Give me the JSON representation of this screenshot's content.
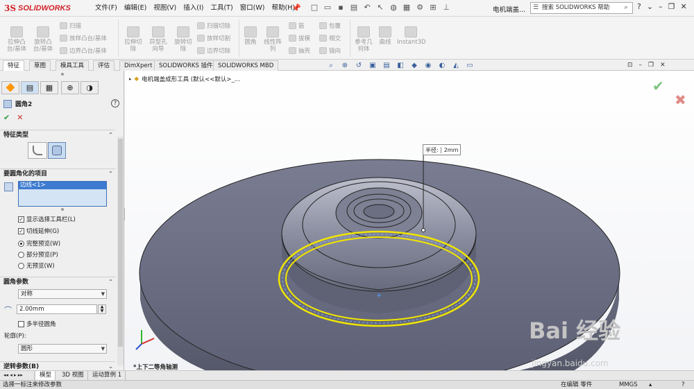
{
  "app": {
    "brand_mark": "3S",
    "brand_name": "SOLIDWORKS"
  },
  "menu": [
    "文件(F)",
    "编辑(E)",
    "视图(V)",
    "插入(I)",
    "工具(T)",
    "窗口(W)",
    "帮助(H)"
  ],
  "doc_title": "电机端盖...",
  "help_search_placeholder": "搜索 SOLIDWORKS 帮助",
  "commands": {
    "extrude_boss": "拉伸凸\n台/基体",
    "revolve_boss": "旋转凸\n台/基体",
    "sweep": "扫描",
    "loft": "放样凸台/基体",
    "boundary": "边界凸台/基体",
    "extrude_cut": "拉伸切\n除",
    "hole_wizard": "异型孔\n向导",
    "revolve_cut": "旋转切\n除",
    "sweep_cut": "扫描切除",
    "loft_cut": "放样切割",
    "boundary_cut": "边界切除",
    "fillet": "圆角",
    "linear_pattern": "线性阵\n列",
    "rib": "筋",
    "draft": "拔模",
    "shell": "抽壳",
    "wrap": "包覆",
    "intersect": "相交",
    "mirror": "镜向",
    "ref_geometry": "参考几\n何体",
    "curves": "曲线",
    "instant3d": "Instant3D"
  },
  "tabs": [
    "特征",
    "草图",
    "模具工具",
    "评估",
    "DimXpert",
    "SOLIDWORKS 插件",
    "SOLIDWORKS MBD"
  ],
  "active_tab": "特征",
  "feature_tree_root": "电机端盖成形工具  (默认<<默认>_...",
  "pm": {
    "title": "圆角2",
    "group_type": "特征类型",
    "group_items": "要圆角化的项目",
    "selected_item": "边线<1>",
    "show_toolbar": "显示选择工具栏(L)",
    "tangent_propagation": "切线延伸(G)",
    "full_preview": "完整预览(W)",
    "partial_preview": "部分预览(P)",
    "no_preview": "无预览(W)",
    "group_params": "圆角参数",
    "symmetric": "对称",
    "radius_value": "2.00mm",
    "multi_radius": "多半径圆角",
    "profile_label": "轮廓(P):",
    "profile_value": "圆形",
    "group_setback": "逆转参数(B)"
  },
  "dimension": {
    "label": "半径:",
    "value": "2mm"
  },
  "view_label": "*上下二等角轴测",
  "bottom_tabs": [
    "模型",
    "3D 视图",
    "运动算例 1"
  ],
  "status": {
    "message": "选择一标注来修改参数",
    "mode": "在编辑 零件",
    "units": "MMGS"
  },
  "watermark": {
    "brand": "Bai 经验",
    "url": "jingyan.baidu.com"
  }
}
